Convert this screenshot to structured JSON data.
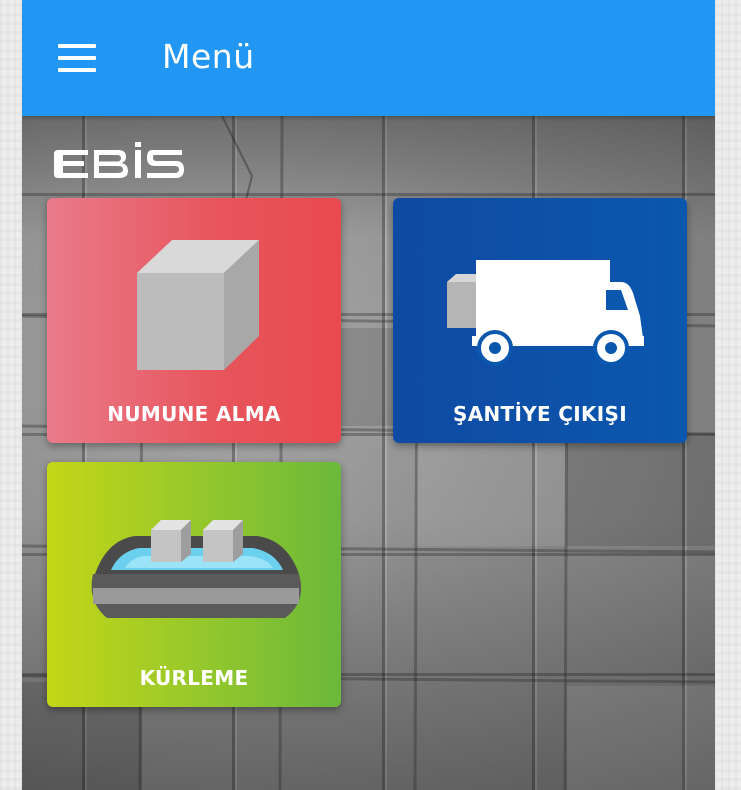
{
  "app_bar": {
    "title": "Menü",
    "menu_icon": "hamburger-menu-icon",
    "color": "#2196f3"
  },
  "brand": {
    "logo_text": "EBİS"
  },
  "tiles": [
    {
      "label": "NUMUNE ALMA",
      "icon": "cube-icon",
      "color": "#e8565e"
    },
    {
      "label": "ŞANTİYE ÇIKIŞI",
      "icon": "truck-icon",
      "color": "#0b57ae"
    },
    {
      "label": "KÜRLEME",
      "icon": "curing-tank-icon",
      "color": "#93c72d"
    }
  ]
}
